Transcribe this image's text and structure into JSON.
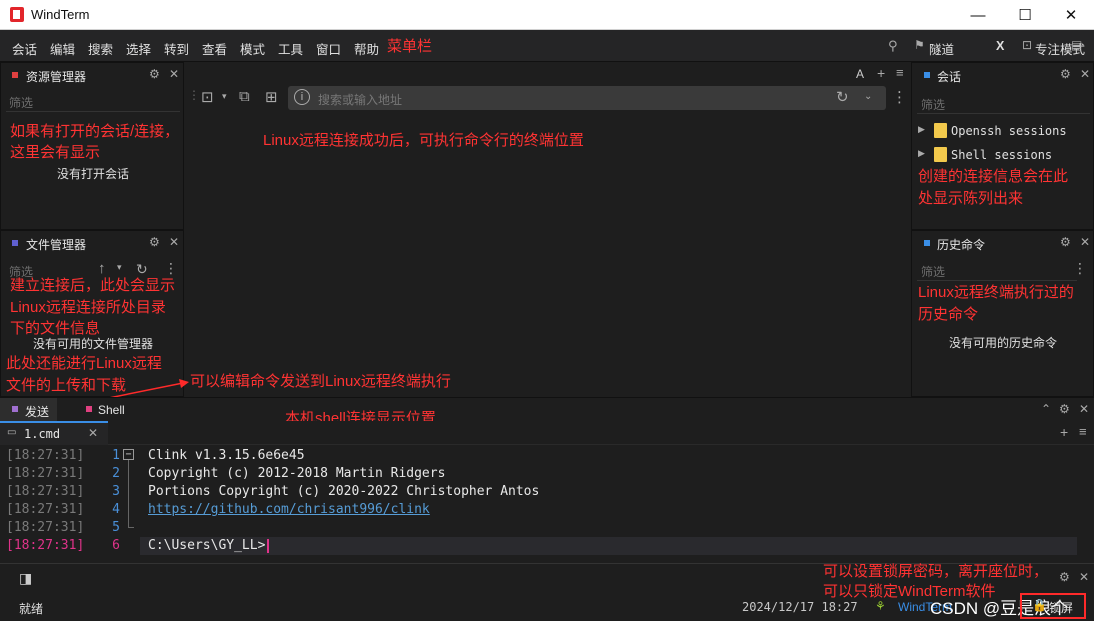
{
  "window": {
    "title": "WindTerm",
    "controls": [
      "—",
      "☐",
      "✕"
    ]
  },
  "menubar": {
    "items": [
      "会话",
      "编辑",
      "搜索",
      "选择",
      "转到",
      "查看",
      "模式",
      "工具",
      "窗口",
      "帮助"
    ],
    "annotation": "菜单栏",
    "right": {
      "tunnel": "隧道",
      "x": "X",
      "focus_mode": "专注模式"
    }
  },
  "explorer": {
    "title": "资源管理器",
    "filter_placeholder": "筛选",
    "annotation_1": "如果有打开的会话/连接，",
    "annotation_2": "这里会有显示",
    "empty": "没有打开会话"
  },
  "filemanager": {
    "title": "文件管理器",
    "filter_placeholder": "筛选",
    "annotation_1": "建立连接后，此处会显示",
    "annotation_2": "Linux远程连接所处目录",
    "annotation_3": "下的文件信息",
    "empty": "没有可用的文件管理器",
    "annotation_4": "此处还能进行Linux远程",
    "annotation_5": "文件的上传和下载"
  },
  "center": {
    "address_placeholder": "搜索或输入地址",
    "annotation": "Linux远程连接成功后，可执行命令行的终端位置",
    "font_label": "A",
    "send_annotation": "可以编辑命令发送到Linux远程终端执行"
  },
  "sessions": {
    "title": "会话",
    "filter_placeholder": "筛选",
    "items": [
      "Openssh sessions",
      "Shell sessions"
    ],
    "annotation_1": "创建的连接信息会在此",
    "annotation_2": "处显示陈列出来"
  },
  "history": {
    "title": "历史命令",
    "filter_placeholder": "筛选",
    "annotation_1": "Linux远程终端执行过的",
    "annotation_2": "历史命令",
    "empty": "没有可用的历史命令"
  },
  "bottom": {
    "tabs": [
      "发送",
      "Shell"
    ],
    "annotation": "本机shell连接显示位置",
    "file_tab": "1.cmd"
  },
  "terminal": {
    "lines": [
      {
        "time": "[18:27:31]",
        "num": "1",
        "text": "Clink v1.3.15.6e6e45"
      },
      {
        "time": "[18:27:31]",
        "num": "2",
        "text": "Copyright (c) 2012-2018 Martin Ridgers"
      },
      {
        "time": "[18:27:31]",
        "num": "3",
        "text": "Portions Copyright (c) 2020-2022 Christopher Antos"
      },
      {
        "time": "[18:27:31]",
        "num": "4",
        "text": "https://github.com/chrisant996/clink"
      },
      {
        "time": "[18:27:31]",
        "num": "5",
        "text": ""
      },
      {
        "time": "[18:27:31]",
        "num": "6",
        "text": "C:\\Users\\GY_LL>"
      }
    ]
  },
  "statusbar": {
    "ready": "就绪",
    "datetime": "2024/12/17  18:27",
    "app": "WindTerm",
    "lock_annotation_1": "可以设置锁屏密码，离开座位时，",
    "lock_annotation_2": "可以只锁定WindTerm软件",
    "lock_label": "锁屏",
    "watermark": "CSDN @豆是浪个"
  },
  "colors": {
    "accent_red": "#ff2a2a",
    "link_blue": "#569cd6",
    "current_line_pink": "#e0338a",
    "session_blue": "#3a8ee6"
  }
}
